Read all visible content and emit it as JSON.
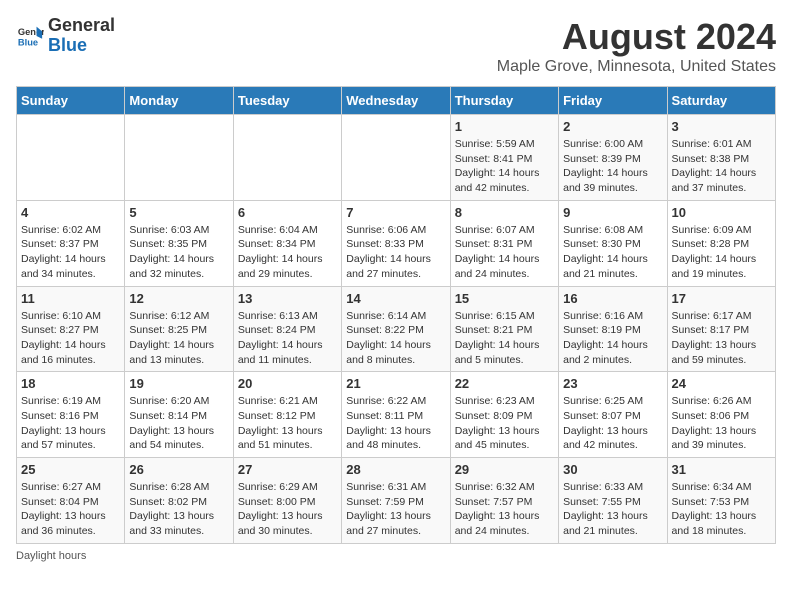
{
  "logo": {
    "text_general": "General",
    "text_blue": "Blue"
  },
  "title": "August 2024",
  "subtitle": "Maple Grove, Minnesota, United States",
  "headers": [
    "Sunday",
    "Monday",
    "Tuesday",
    "Wednesday",
    "Thursday",
    "Friday",
    "Saturday"
  ],
  "weeks": [
    [
      {
        "day": "",
        "info": ""
      },
      {
        "day": "",
        "info": ""
      },
      {
        "day": "",
        "info": ""
      },
      {
        "day": "",
        "info": ""
      },
      {
        "day": "1",
        "info": "Sunrise: 5:59 AM\nSunset: 8:41 PM\nDaylight: 14 hours and 42 minutes."
      },
      {
        "day": "2",
        "info": "Sunrise: 6:00 AM\nSunset: 8:39 PM\nDaylight: 14 hours and 39 minutes."
      },
      {
        "day": "3",
        "info": "Sunrise: 6:01 AM\nSunset: 8:38 PM\nDaylight: 14 hours and 37 minutes."
      }
    ],
    [
      {
        "day": "4",
        "info": "Sunrise: 6:02 AM\nSunset: 8:37 PM\nDaylight: 14 hours and 34 minutes."
      },
      {
        "day": "5",
        "info": "Sunrise: 6:03 AM\nSunset: 8:35 PM\nDaylight: 14 hours and 32 minutes."
      },
      {
        "day": "6",
        "info": "Sunrise: 6:04 AM\nSunset: 8:34 PM\nDaylight: 14 hours and 29 minutes."
      },
      {
        "day": "7",
        "info": "Sunrise: 6:06 AM\nSunset: 8:33 PM\nDaylight: 14 hours and 27 minutes."
      },
      {
        "day": "8",
        "info": "Sunrise: 6:07 AM\nSunset: 8:31 PM\nDaylight: 14 hours and 24 minutes."
      },
      {
        "day": "9",
        "info": "Sunrise: 6:08 AM\nSunset: 8:30 PM\nDaylight: 14 hours and 21 minutes."
      },
      {
        "day": "10",
        "info": "Sunrise: 6:09 AM\nSunset: 8:28 PM\nDaylight: 14 hours and 19 minutes."
      }
    ],
    [
      {
        "day": "11",
        "info": "Sunrise: 6:10 AM\nSunset: 8:27 PM\nDaylight: 14 hours and 16 minutes."
      },
      {
        "day": "12",
        "info": "Sunrise: 6:12 AM\nSunset: 8:25 PM\nDaylight: 14 hours and 13 minutes."
      },
      {
        "day": "13",
        "info": "Sunrise: 6:13 AM\nSunset: 8:24 PM\nDaylight: 14 hours and 11 minutes."
      },
      {
        "day": "14",
        "info": "Sunrise: 6:14 AM\nSunset: 8:22 PM\nDaylight: 14 hours and 8 minutes."
      },
      {
        "day": "15",
        "info": "Sunrise: 6:15 AM\nSunset: 8:21 PM\nDaylight: 14 hours and 5 minutes."
      },
      {
        "day": "16",
        "info": "Sunrise: 6:16 AM\nSunset: 8:19 PM\nDaylight: 14 hours and 2 minutes."
      },
      {
        "day": "17",
        "info": "Sunrise: 6:17 AM\nSunset: 8:17 PM\nDaylight: 13 hours and 59 minutes."
      }
    ],
    [
      {
        "day": "18",
        "info": "Sunrise: 6:19 AM\nSunset: 8:16 PM\nDaylight: 13 hours and 57 minutes."
      },
      {
        "day": "19",
        "info": "Sunrise: 6:20 AM\nSunset: 8:14 PM\nDaylight: 13 hours and 54 minutes."
      },
      {
        "day": "20",
        "info": "Sunrise: 6:21 AM\nSunset: 8:12 PM\nDaylight: 13 hours and 51 minutes."
      },
      {
        "day": "21",
        "info": "Sunrise: 6:22 AM\nSunset: 8:11 PM\nDaylight: 13 hours and 48 minutes."
      },
      {
        "day": "22",
        "info": "Sunrise: 6:23 AM\nSunset: 8:09 PM\nDaylight: 13 hours and 45 minutes."
      },
      {
        "day": "23",
        "info": "Sunrise: 6:25 AM\nSunset: 8:07 PM\nDaylight: 13 hours and 42 minutes."
      },
      {
        "day": "24",
        "info": "Sunrise: 6:26 AM\nSunset: 8:06 PM\nDaylight: 13 hours and 39 minutes."
      }
    ],
    [
      {
        "day": "25",
        "info": "Sunrise: 6:27 AM\nSunset: 8:04 PM\nDaylight: 13 hours and 36 minutes."
      },
      {
        "day": "26",
        "info": "Sunrise: 6:28 AM\nSunset: 8:02 PM\nDaylight: 13 hours and 33 minutes."
      },
      {
        "day": "27",
        "info": "Sunrise: 6:29 AM\nSunset: 8:00 PM\nDaylight: 13 hours and 30 minutes."
      },
      {
        "day": "28",
        "info": "Sunrise: 6:31 AM\nSunset: 7:59 PM\nDaylight: 13 hours and 27 minutes."
      },
      {
        "day": "29",
        "info": "Sunrise: 6:32 AM\nSunset: 7:57 PM\nDaylight: 13 hours and 24 minutes."
      },
      {
        "day": "30",
        "info": "Sunrise: 6:33 AM\nSunset: 7:55 PM\nDaylight: 13 hours and 21 minutes."
      },
      {
        "day": "31",
        "info": "Sunrise: 6:34 AM\nSunset: 7:53 PM\nDaylight: 13 hours and 18 minutes."
      }
    ]
  ],
  "footer": "Daylight hours"
}
